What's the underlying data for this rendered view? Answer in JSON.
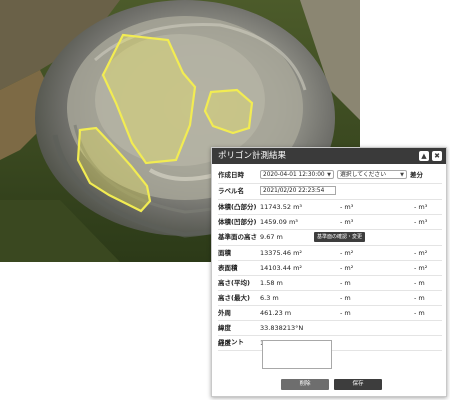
{
  "panel": {
    "title": "ポリゴン計測結果",
    "collapse_glyph": "▲",
    "close_glyph": "✖"
  },
  "rows": {
    "created": {
      "label": "作成日時",
      "select1": "2020-04-01 12:30:00",
      "select2": "選択してください",
      "diff": "差分"
    },
    "label_name": {
      "label": "ラベル名",
      "value": "2021/02/20 22:23:54"
    },
    "vol_convex": {
      "label": "体積(凸部分)",
      "v1": "11743.52 m³",
      "v2": "- m³",
      "v3": "- m³"
    },
    "vol_concave": {
      "label": "体積(凹部分)",
      "v1": "1459.09 m³",
      "v2": "- m³",
      "v3": "- m³"
    },
    "base_height": {
      "label": "基準面の高さ",
      "v1": "9.67 m",
      "button": "基準面の確認・変更"
    },
    "area": {
      "label": "面積",
      "v1": "13375.46 m²",
      "v2": "- m²",
      "v3": "- m²"
    },
    "surface": {
      "label": "表面積",
      "v1": "14103.44 m²",
      "v2": "- m²",
      "v3": "- m²"
    },
    "height_avg": {
      "label": "高さ(平均)",
      "v1": "1.58 m",
      "v2": "- m",
      "v3": "- m"
    },
    "height_max": {
      "label": "高さ(最大)",
      "v1": "6.3 m",
      "v2": "- m",
      "v3": "- m"
    },
    "perimeter": {
      "label": "外周",
      "v1": "461.23 m",
      "v2": "- m",
      "v3": "- m"
    },
    "latitude": {
      "label": "緯度",
      "v1": "33.838213°N"
    },
    "longitude": {
      "label": "経度",
      "v1": "130.853032°E"
    }
  },
  "comment": {
    "label": "コメント",
    "value": ""
  },
  "buttons": {
    "delete": "削除",
    "save": "保存"
  },
  "colors": {
    "polygon": "#f2ec52",
    "titlebar": "#3a3a3a"
  }
}
